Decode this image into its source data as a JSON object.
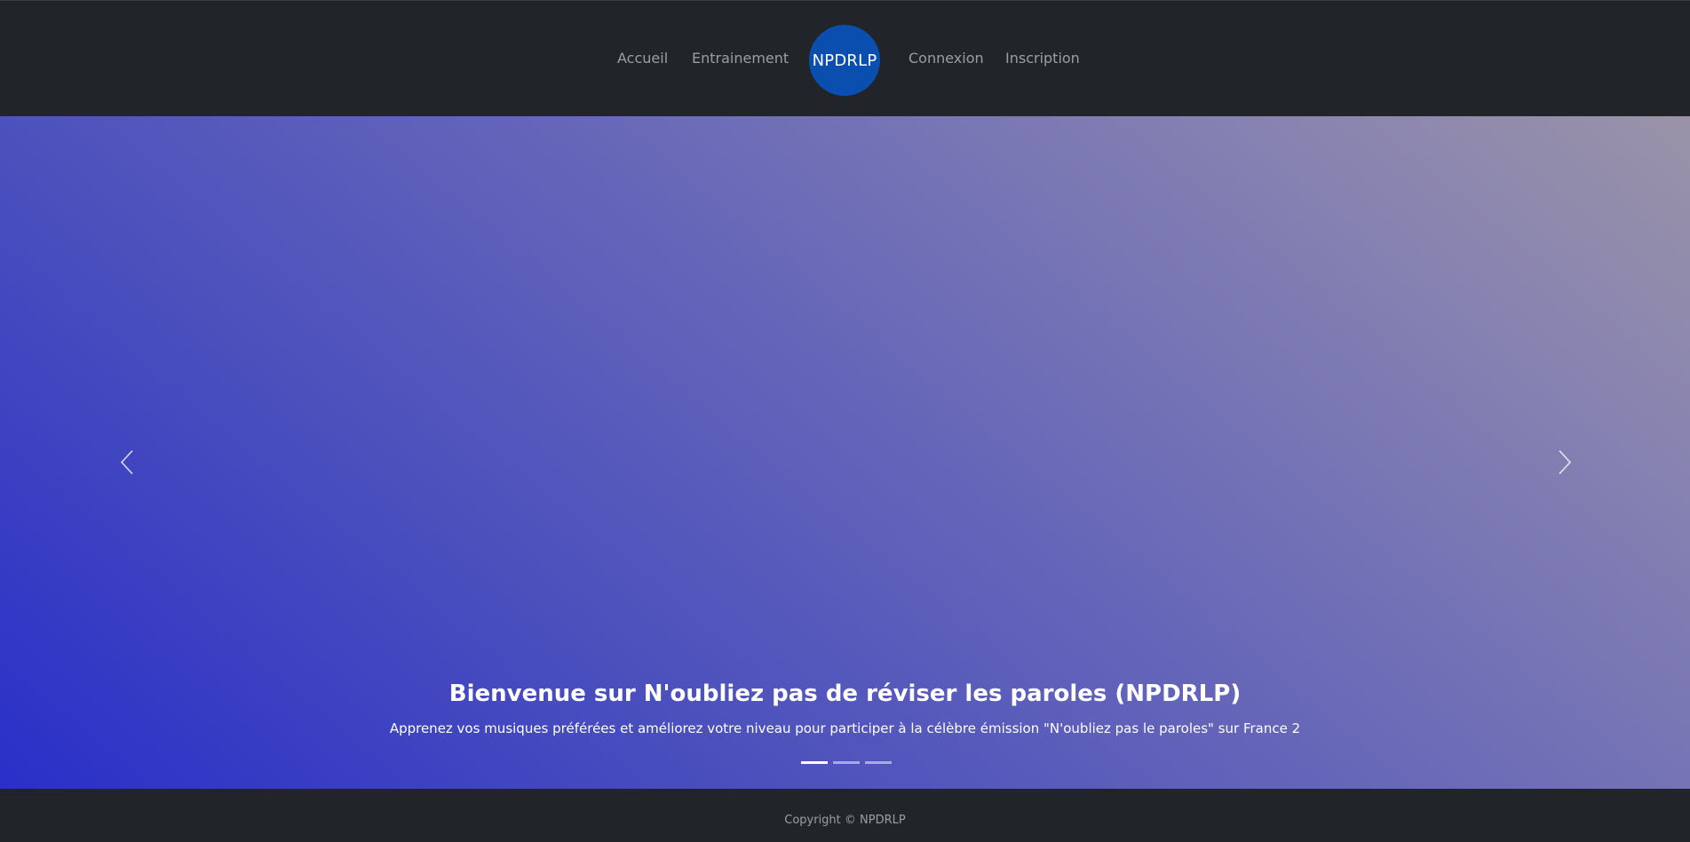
{
  "nav": {
    "links": [
      {
        "label": "Accueil"
      },
      {
        "label": "Entrainement"
      },
      {
        "label": "Connexion"
      },
      {
        "label": "Inscription"
      }
    ],
    "logo_text": "NPDRLP"
  },
  "carousel": {
    "title": "Bienvenue sur N'oubliez pas de réviser les paroles (NPDRLP)",
    "subtitle": "Apprenez vos musiques préférées et améliorez votre niveau pour participer à la célèbre émission \"N'oubliez pas le paroles\" sur France 2",
    "slide_count": 3,
    "active_slide": 1,
    "prev_icon": "chevron-left-icon",
    "next_icon": "chevron-right-icon"
  },
  "footer": {
    "copyright": "Copyright © NPDRLP"
  },
  "colors": {
    "navbar_bg": "#212529",
    "logo_bg": "#0a4fb0",
    "gradient_start": "#2a2fc9",
    "gradient_end": "#9a93a8"
  }
}
